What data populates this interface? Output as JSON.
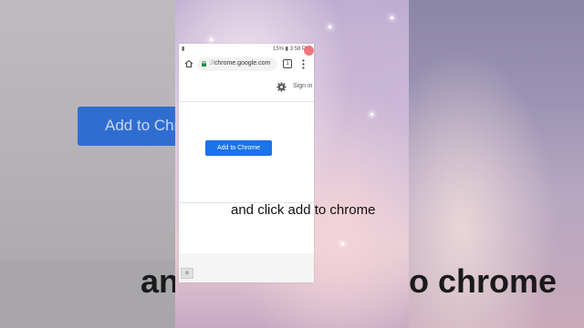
{
  "status_bar": {
    "left_indicator": "▮",
    "right_text": "15% ▮ 3:58 PM"
  },
  "browser": {
    "url": "chrome.google.com",
    "url_prefix": "://",
    "tab_count": "1",
    "sign_in_label": "Sign in"
  },
  "page": {
    "add_button_label": "Add to Chrome"
  },
  "background_left_button": {
    "label": "Add to Chr"
  },
  "captions": {
    "small": "and click add to chrome",
    "big_left": "an",
    "big_right": "o chrome"
  },
  "colors": {
    "button_blue": "#1a73e8",
    "record_dot": "#ef6a6f"
  },
  "icons": {
    "home": "home-icon",
    "lock": "lock-icon",
    "tabs": "tabs-icon",
    "menu": "menu-icon",
    "settings": "gear-icon"
  }
}
